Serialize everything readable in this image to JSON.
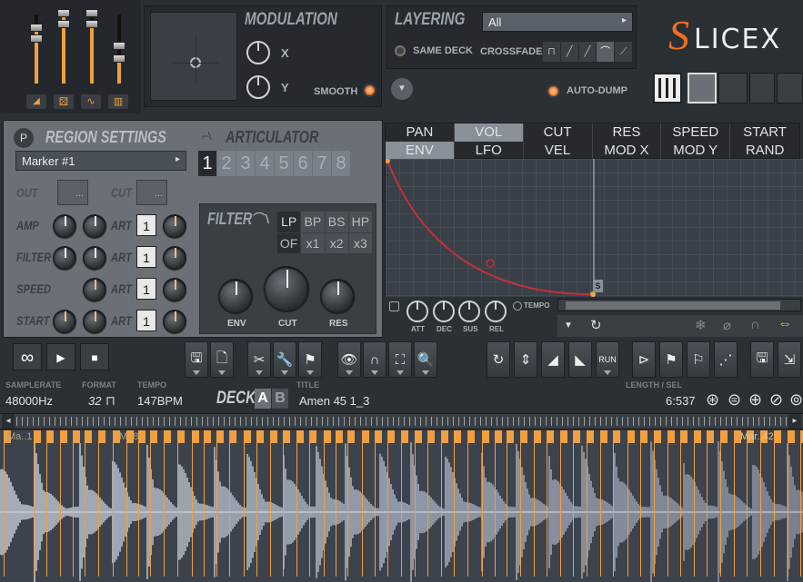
{
  "app": {
    "logo_text": "LICEX",
    "logo_prefix": "S"
  },
  "modulation": {
    "title": "MODULATION",
    "x_label": "X",
    "y_label": "Y",
    "smooth_label": "SMOOTH"
  },
  "layering": {
    "title": "LAYERING",
    "select_value": "All",
    "same_deck_label": "SAME DECK",
    "crossfade_label": "CROSSFADE",
    "auto_dump_label": "AUTO-DUMP"
  },
  "region": {
    "title": "REGION SETTINGS",
    "marker_value": "Marker #1",
    "out_label": "OUT",
    "cut_label": "CUT",
    "rows": [
      {
        "label": "AMP",
        "art": "ART",
        "num": "1"
      },
      {
        "label": "FILTER",
        "art": "ART",
        "num": "1"
      },
      {
        "label": "SPEED",
        "art": "ART",
        "num": "1"
      },
      {
        "label": "START",
        "art": "ART",
        "num": "1"
      }
    ]
  },
  "articulator": {
    "title": "ARTICULATOR",
    "numbers": [
      "1",
      "2",
      "3",
      "4",
      "5",
      "6",
      "7",
      "8"
    ]
  },
  "filter": {
    "title": "FILTER",
    "types_row1": [
      "LP",
      "BP",
      "BS",
      "HP"
    ],
    "types_row2": [
      "OF",
      "x1",
      "x2",
      "x3"
    ],
    "knobs": [
      "ENV",
      "CUT",
      "RES"
    ]
  },
  "env_tabs": {
    "row1": [
      "PAN",
      "VOL",
      "CUT",
      "RES",
      "SPEED",
      "START"
    ],
    "row2": [
      "ENV",
      "LFO",
      "VEL",
      "MOD X",
      "MOD Y",
      "RAND"
    ]
  },
  "adsr": {
    "labels": [
      "ATT",
      "DEC",
      "SUS",
      "REL"
    ],
    "tempo_label": "TEMPO"
  },
  "info": {
    "samplerate_label": "SAMPLERATE",
    "samplerate_value": "48000Hz",
    "format_label": "FORMAT",
    "format_value": "32",
    "tempo_label": "TEMPO",
    "tempo_value": "147BPM",
    "title_label": "TITLE",
    "title_value": "Amen 45 1_3",
    "deck_label": "DECK",
    "deck_a": "A",
    "deck_b": "B",
    "length_label": "LENGTH / SEL",
    "length_value": "6:537"
  },
  "markers": {
    "labels": [
      "Ma..1",
      "M..8",
      "Mar..42"
    ]
  },
  "colors": {
    "accent": "#f0a040",
    "envelope": "#c0303a",
    "grid_bg": "#3a4048"
  }
}
